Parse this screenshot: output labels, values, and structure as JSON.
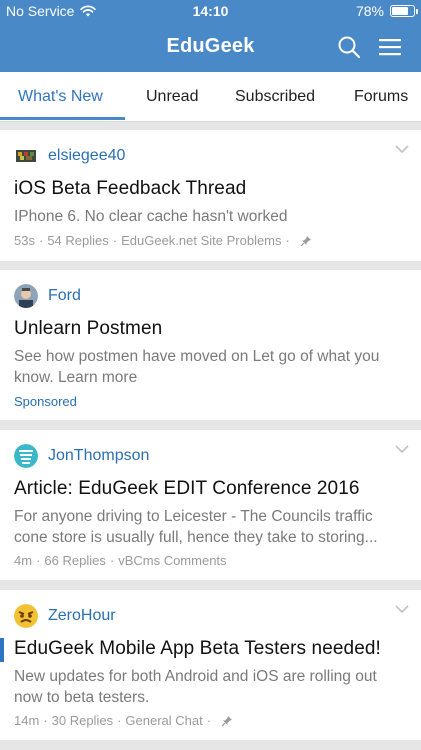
{
  "status_bar": {
    "carrier": "No Service",
    "time": "14:10",
    "battery_text": "78%",
    "battery_level": 0.78
  },
  "nav": {
    "title": "EduGeek",
    "search_icon": "search-icon",
    "menu_icon": "hamburger-menu-icon"
  },
  "tabs": [
    {
      "label": "What's New",
      "active": true
    },
    {
      "label": "Unread",
      "active": false
    },
    {
      "label": "Subscribed",
      "active": false
    },
    {
      "label": "Forums",
      "active": false
    }
  ],
  "feed": [
    {
      "author": "elsiegee40",
      "title": "iOS Beta Feedback Thread",
      "snippet": "IPhone 6. No clear cache hasn't worked",
      "meta": {
        "time": "53s",
        "replies": "54 Replies",
        "forum": "EduGeek.net Site Problems",
        "pinned": true
      }
    },
    {
      "author": "Ford",
      "title": "Unlearn Postmen",
      "snippet": "See how postmen have moved on Let go of what you know. Learn more",
      "sponsored_label": "Sponsored"
    },
    {
      "author": "JonThompson",
      "title": "Article: EduGeek EDIT Conference 2016",
      "snippet": "For anyone driving to Leicester - The Councils traffic cone store is usually full, hence they take to storing...",
      "meta": {
        "time": "4m",
        "replies": "66 Replies",
        "forum": "vBCms Comments",
        "pinned": false
      }
    },
    {
      "author": "ZeroHour",
      "title": "EduGeek Mobile App Beta Testers needed!",
      "snippet": "New updates for both Android and iOS are rolling out now to beta testers.",
      "meta": {
        "time": "14m",
        "replies": "30 Replies",
        "forum": "General Chat",
        "pinned": true
      },
      "unread": true
    }
  ],
  "colors": {
    "brand": "#4a89c8",
    "link": "#2a6fb3",
    "muted": "#7a7a7a"
  }
}
